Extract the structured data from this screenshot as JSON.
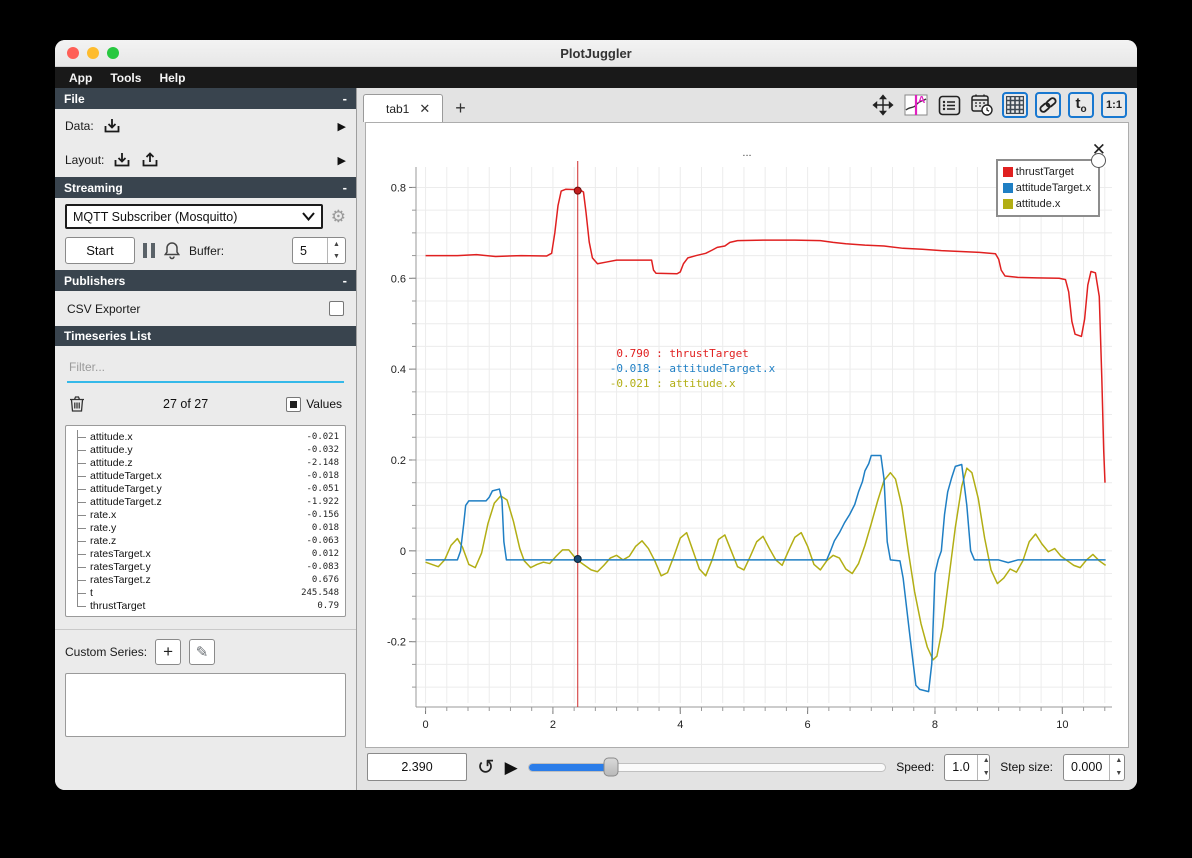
{
  "glyphs": {
    "close": "✕",
    "add": "+",
    "arrow_right": "▶",
    "play": "▶",
    "loop": "↻",
    "minus": "-",
    "up": "▲",
    "down": "▼",
    "plus": "+",
    "pencil": "✎",
    "gear": "⚙",
    "ellipsis": "..."
  },
  "window": {
    "title": "PlotJuggler",
    "menu": [
      "App",
      "Tools",
      "Help"
    ]
  },
  "sidebar": {
    "file": {
      "header": "File",
      "data_label": "Data:",
      "layout_label": "Layout:"
    },
    "streaming": {
      "header": "Streaming",
      "source": "MQTT Subscriber (Mosquitto)",
      "start_label": "Start",
      "buffer_label": "Buffer:",
      "buffer_value": "5"
    },
    "publishers": {
      "header": "Publishers",
      "csv_exporter_label": "CSV Exporter"
    },
    "timeseries": {
      "header": "Timeseries List",
      "filter_placeholder": "Filter...",
      "count": "27 of 27",
      "values_label": "Values",
      "custom_series_label": "Custom Series:",
      "items": [
        {
          "name": "attitude.x",
          "value": "-0.021"
        },
        {
          "name": "attitude.y",
          "value": "-0.032"
        },
        {
          "name": "attitude.z",
          "value": "-2.148"
        },
        {
          "name": "attitudeTarget.x",
          "value": "-0.018"
        },
        {
          "name": "attitudeTarget.y",
          "value": "-0.051"
        },
        {
          "name": "attitudeTarget.z",
          "value": "-1.922"
        },
        {
          "name": "rate.x",
          "value": "-0.156"
        },
        {
          "name": "rate.y",
          "value": "0.018"
        },
        {
          "name": "rate.z",
          "value": "-0.063"
        },
        {
          "name": "ratesTarget.x",
          "value": "0.012"
        },
        {
          "name": "ratesTarget.y",
          "value": "-0.083"
        },
        {
          "name": "ratesTarget.z",
          "value": "0.676"
        },
        {
          "name": "t",
          "value": "245.548"
        },
        {
          "name": "thrustTarget",
          "value": "0.79"
        }
      ]
    }
  },
  "tabs": {
    "active": "tab1"
  },
  "toolbar": {
    "t0_main": "t",
    "t0_sub": "o",
    "ratio": "1:1"
  },
  "plot": {
    "title": "...",
    "tracker_x": 2.39,
    "tracker_markers": [
      {
        "y": 0.793,
        "fill": "#c21f1f",
        "stroke": "#6e0c0c"
      },
      {
        "y": -0.018,
        "fill": "#184a73",
        "stroke": "#0b2438"
      }
    ],
    "tooltip": {
      "lines": [
        {
          "value": " 0.790",
          "name": "thrustTarget",
          "color": "#e02020"
        },
        {
          "value": "-0.018",
          "name": "attitudeTarget.x",
          "color": "#1f7fc4"
        },
        {
          "value": "-0.021",
          "name": "attitude.x",
          "color": "#b2ae14"
        }
      ]
    }
  },
  "transport": {
    "time": "2.390",
    "speed_label": "Speed:",
    "speed": "1.0",
    "step_label": "Step size:",
    "step": "0.000",
    "slider_pos": 0.23
  },
  "chart_data": {
    "type": "line",
    "title": "...",
    "xlabel": "",
    "ylabel": "",
    "xlim": [
      -0.15,
      10.78
    ],
    "ylim": [
      -0.335,
      0.845
    ],
    "x_ticks": [
      0,
      2,
      4,
      6,
      8,
      10
    ],
    "y_ticks": [
      -0.2,
      0,
      0.2,
      0.4,
      0.6,
      0.8
    ],
    "grid": true,
    "legend_position": "top-right",
    "series": [
      {
        "name": "attitude.x",
        "color": "#b2ae14",
        "points": [
          [
            0,
            -0.025
          ],
          [
            0.1,
            -0.03
          ],
          [
            0.2,
            -0.035
          ],
          [
            0.3,
            -0.02
          ],
          [
            0.4,
            0.012
          ],
          [
            0.5,
            0.027
          ],
          [
            0.58,
            0.008
          ],
          [
            0.68,
            -0.03
          ],
          [
            0.78,
            -0.037
          ],
          [
            0.88,
            -0.005
          ],
          [
            0.98,
            0.06
          ],
          [
            1.08,
            0.105
          ],
          [
            1.18,
            0.121
          ],
          [
            1.28,
            0.112
          ],
          [
            1.38,
            0.065
          ],
          [
            1.48,
            0.005
          ],
          [
            1.55,
            -0.022
          ],
          [
            1.65,
            -0.037
          ],
          [
            1.75,
            -0.03
          ],
          [
            1.85,
            -0.025
          ],
          [
            1.95,
            -0.028
          ],
          [
            2.05,
            -0.012
          ],
          [
            2.15,
            0.002
          ],
          [
            2.25,
            0.002
          ],
          [
            2.33,
            -0.012
          ],
          [
            2.39,
            -0.021
          ],
          [
            2.5,
            -0.032
          ],
          [
            2.6,
            -0.042
          ],
          [
            2.7,
            -0.046
          ],
          [
            2.8,
            -0.032
          ],
          [
            2.9,
            -0.016
          ],
          [
            3.0,
            -0.01
          ],
          [
            3.1,
            -0.02
          ],
          [
            3.2,
            -0.012
          ],
          [
            3.3,
            0.01
          ],
          [
            3.4,
            0.022
          ],
          [
            3.5,
            0.005
          ],
          [
            3.6,
            -0.022
          ],
          [
            3.7,
            -0.055
          ],
          [
            3.8,
            -0.048
          ],
          [
            3.9,
            -0.012
          ],
          [
            4.0,
            0.028
          ],
          [
            4.1,
            0.04
          ],
          [
            4.2,
            0.0
          ],
          [
            4.3,
            -0.04
          ],
          [
            4.4,
            -0.055
          ],
          [
            4.5,
            -0.02
          ],
          [
            4.6,
            0.025
          ],
          [
            4.7,
            0.035
          ],
          [
            4.8,
            0.0
          ],
          [
            4.9,
            -0.035
          ],
          [
            5.0,
            -0.042
          ],
          [
            5.1,
            -0.012
          ],
          [
            5.2,
            0.02
          ],
          [
            5.3,
            0.032
          ],
          [
            5.4,
            0.005
          ],
          [
            5.5,
            -0.02
          ],
          [
            5.6,
            -0.032
          ],
          [
            5.7,
            0.0
          ],
          [
            5.8,
            0.03
          ],
          [
            5.9,
            0.04
          ],
          [
            6.0,
            0.01
          ],
          [
            6.1,
            -0.03
          ],
          [
            6.2,
            -0.042
          ],
          [
            6.3,
            -0.022
          ],
          [
            6.4,
            -0.01
          ],
          [
            6.5,
            -0.016
          ],
          [
            6.6,
            -0.04
          ],
          [
            6.7,
            -0.05
          ],
          [
            6.8,
            -0.028
          ],
          [
            6.9,
            0.012
          ],
          [
            7.0,
            0.06
          ],
          [
            7.1,
            0.11
          ],
          [
            7.2,
            0.155
          ],
          [
            7.3,
            0.172
          ],
          [
            7.38,
            0.158
          ],
          [
            7.48,
            0.098
          ],
          [
            7.58,
            0.0
          ],
          [
            7.68,
            -0.09
          ],
          [
            7.78,
            -0.16
          ],
          [
            7.88,
            -0.212
          ],
          [
            7.97,
            -0.24
          ],
          [
            8.03,
            -0.232
          ],
          [
            8.12,
            -0.168
          ],
          [
            8.22,
            -0.058
          ],
          [
            8.32,
            0.052
          ],
          [
            8.42,
            0.142
          ],
          [
            8.5,
            0.182
          ],
          [
            8.58,
            0.172
          ],
          [
            8.68,
            0.115
          ],
          [
            8.78,
            0.028
          ],
          [
            8.88,
            -0.042
          ],
          [
            8.98,
            -0.072
          ],
          [
            9.08,
            -0.06
          ],
          [
            9.18,
            -0.04
          ],
          [
            9.28,
            -0.047
          ],
          [
            9.38,
            -0.022
          ],
          [
            9.48,
            0.02
          ],
          [
            9.58,
            0.037
          ],
          [
            9.68,
            0.015
          ],
          [
            9.78,
            -0.002
          ],
          [
            9.88,
            0.005
          ],
          [
            9.98,
            -0.012
          ],
          [
            10.08,
            -0.022
          ],
          [
            10.18,
            -0.032
          ],
          [
            10.28,
            -0.037
          ],
          [
            10.38,
            -0.02
          ],
          [
            10.48,
            -0.008
          ],
          [
            10.58,
            -0.022
          ],
          [
            10.68,
            -0.032
          ]
        ]
      },
      {
        "name": "attitudeTarget.x",
        "color": "#1f7fc4",
        "points": [
          [
            0,
            -0.02
          ],
          [
            0.5,
            -0.02
          ],
          [
            0.55,
            0.0
          ],
          [
            0.6,
            0.06
          ],
          [
            0.63,
            0.1
          ],
          [
            0.68,
            0.11
          ],
          [
            0.95,
            0.11
          ],
          [
            1.0,
            0.118
          ],
          [
            1.05,
            0.132
          ],
          [
            1.16,
            0.136
          ],
          [
            1.2,
            0.112
          ],
          [
            1.23,
            0.02
          ],
          [
            1.27,
            -0.02
          ],
          [
            2.0,
            -0.02
          ],
          [
            3.5,
            -0.02
          ],
          [
            5.0,
            -0.02
          ],
          [
            6.3,
            -0.02
          ],
          [
            6.36,
            0.0
          ],
          [
            6.42,
            0.022
          ],
          [
            6.5,
            0.04
          ],
          [
            6.58,
            0.062
          ],
          [
            6.66,
            0.08
          ],
          [
            6.74,
            0.102
          ],
          [
            6.8,
            0.13
          ],
          [
            6.86,
            0.152
          ],
          [
            6.9,
            0.176
          ],
          [
            6.96,
            0.192
          ],
          [
            7.0,
            0.21
          ],
          [
            7.15,
            0.21
          ],
          [
            7.2,
            0.158
          ],
          [
            7.25,
            0.02
          ],
          [
            7.3,
            -0.02
          ],
          [
            7.45,
            -0.022
          ],
          [
            7.5,
            -0.06
          ],
          [
            7.55,
            -0.12
          ],
          [
            7.6,
            -0.18
          ],
          [
            7.66,
            -0.25
          ],
          [
            7.7,
            -0.296
          ],
          [
            7.76,
            -0.305
          ],
          [
            7.9,
            -0.31
          ],
          [
            7.95,
            -0.248
          ],
          [
            8.0,
            -0.05
          ],
          [
            8.05,
            -0.02
          ],
          [
            8.1,
            0.0
          ],
          [
            8.15,
            0.08
          ],
          [
            8.2,
            0.13
          ],
          [
            8.26,
            0.16
          ],
          [
            8.32,
            0.186
          ],
          [
            8.42,
            0.19
          ],
          [
            8.5,
            0.1
          ],
          [
            8.56,
            0.0
          ],
          [
            8.62,
            -0.02
          ],
          [
            9.0,
            -0.02
          ],
          [
            9.15,
            -0.026
          ],
          [
            9.3,
            -0.02
          ],
          [
            10.68,
            -0.02
          ]
        ]
      },
      {
        "name": "thrustTarget",
        "color": "#e02020",
        "points": [
          [
            0,
            0.65
          ],
          [
            0.5,
            0.65
          ],
          [
            0.8,
            0.652
          ],
          [
            1.1,
            0.648
          ],
          [
            1.5,
            0.65
          ],
          [
            1.9,
            0.649
          ],
          [
            1.98,
            0.655
          ],
          [
            2.03,
            0.7
          ],
          [
            2.08,
            0.76
          ],
          [
            2.13,
            0.792
          ],
          [
            2.2,
            0.796
          ],
          [
            2.42,
            0.795
          ],
          [
            2.48,
            0.79
          ],
          [
            2.52,
            0.745
          ],
          [
            2.57,
            0.68
          ],
          [
            2.62,
            0.645
          ],
          [
            2.7,
            0.632
          ],
          [
            2.85,
            0.636
          ],
          [
            3.0,
            0.64
          ],
          [
            3.3,
            0.64
          ],
          [
            3.55,
            0.64
          ],
          [
            3.58,
            0.618
          ],
          [
            3.62,
            0.611
          ],
          [
            3.95,
            0.61
          ],
          [
            4.0,
            0.614
          ],
          [
            4.05,
            0.632
          ],
          [
            4.12,
            0.645
          ],
          [
            4.25,
            0.65
          ],
          [
            4.4,
            0.655
          ],
          [
            4.5,
            0.662
          ],
          [
            4.58,
            0.668
          ],
          [
            4.7,
            0.671
          ],
          [
            4.78,
            0.679
          ],
          [
            4.9,
            0.683
          ],
          [
            5.3,
            0.684
          ],
          [
            5.8,
            0.684
          ],
          [
            6.2,
            0.683
          ],
          [
            6.4,
            0.679
          ],
          [
            6.6,
            0.676
          ],
          [
            6.9,
            0.673
          ],
          [
            7.2,
            0.671
          ],
          [
            7.5,
            0.666
          ],
          [
            7.8,
            0.664
          ],
          [
            8.1,
            0.661
          ],
          [
            8.4,
            0.659
          ],
          [
            8.7,
            0.657
          ],
          [
            8.95,
            0.654
          ],
          [
            9.0,
            0.642
          ],
          [
            9.04,
            0.618
          ],
          [
            9.1,
            0.605
          ],
          [
            9.3,
            0.602
          ],
          [
            9.6,
            0.601
          ],
          [
            9.95,
            0.6
          ],
          [
            10.05,
            0.597
          ],
          [
            10.1,
            0.57
          ],
          [
            10.15,
            0.505
          ],
          [
            10.2,
            0.477
          ],
          [
            10.3,
            0.472
          ],
          [
            10.35,
            0.51
          ],
          [
            10.4,
            0.585
          ],
          [
            10.45,
            0.615
          ],
          [
            10.52,
            0.612
          ],
          [
            10.58,
            0.56
          ],
          [
            10.62,
            0.38
          ],
          [
            10.65,
            0.22
          ],
          [
            10.67,
            0.15
          ]
        ]
      }
    ]
  }
}
